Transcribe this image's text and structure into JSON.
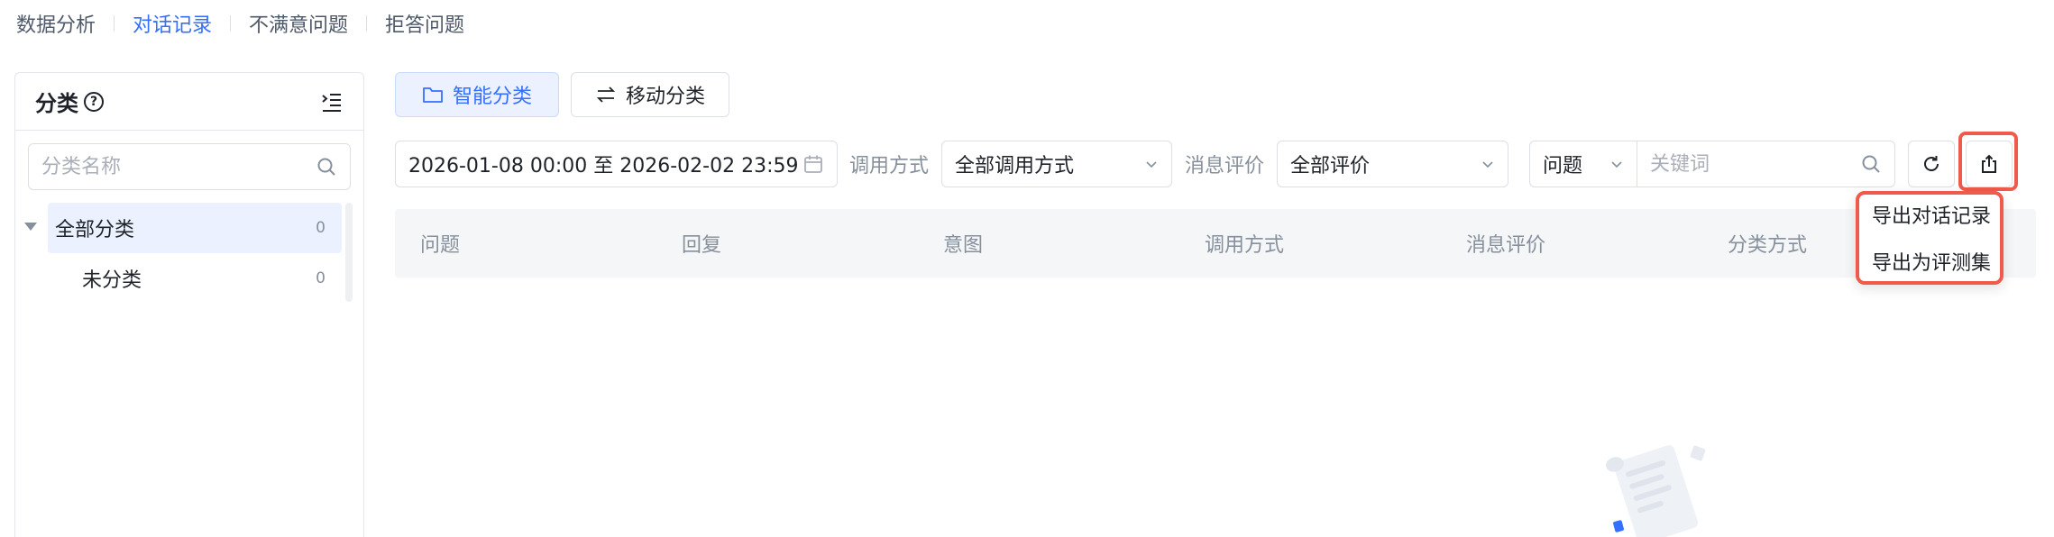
{
  "top_tabs": [
    {
      "label": "数据分析",
      "active": false
    },
    {
      "label": "对话记录",
      "active": true
    },
    {
      "label": "不满意问题",
      "active": false
    },
    {
      "label": "拒答问题",
      "active": false
    }
  ],
  "sidebar": {
    "title": "分类",
    "help_glyph": "?",
    "search_placeholder": "分类名称",
    "tree": [
      {
        "label": "全部分类",
        "count": "0",
        "expanded": true,
        "selected": true
      },
      {
        "label": "未分类",
        "count": "0",
        "expanded": false,
        "selected": false
      }
    ]
  },
  "toolbar": {
    "smart_classify_label": "智能分类",
    "move_classify_label": "移动分类"
  },
  "filters": {
    "date_range": "2026-01-08 00:00 至 2026-02-02 23:59",
    "call_method_label": "调用方式",
    "call_method_value": "全部调用方式",
    "evaluation_label": "消息评价",
    "evaluation_value": "全部评价",
    "search_type": "问题",
    "keyword_placeholder": "关键词"
  },
  "table": {
    "columns": [
      "问题",
      "回复",
      "意图",
      "调用方式",
      "消息评价",
      "分类方式"
    ]
  },
  "export_menu": {
    "items": [
      "导出对话记录",
      "导出为评测集"
    ]
  },
  "colors": {
    "accent": "#3370ff",
    "highlight": "#f05a4a",
    "muted_text": "#86909c",
    "border": "#dcdfe6"
  }
}
